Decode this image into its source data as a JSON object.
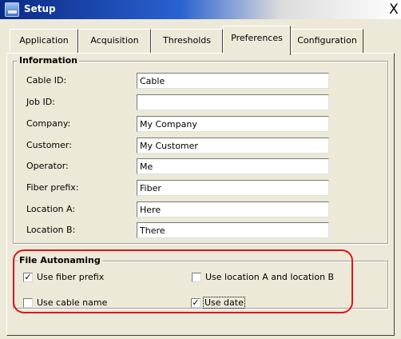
{
  "window": {
    "title": "Setup",
    "close_glyph": "X"
  },
  "tabs": [
    {
      "label": "Application"
    },
    {
      "label": "Acquisition"
    },
    {
      "label": "Thresholds"
    },
    {
      "label": "Preferences",
      "active": true
    },
    {
      "label": "Configuration"
    }
  ],
  "information": {
    "title": "Information",
    "fields": [
      {
        "label": "Cable ID:",
        "value": "Cable"
      },
      {
        "label": "Job ID:",
        "value": ""
      },
      {
        "label": "Company:",
        "value": "My Company"
      },
      {
        "label": "Customer:",
        "value": "My Customer"
      },
      {
        "label": "Operator:",
        "value": "Me"
      },
      {
        "label": "Fiber prefix:",
        "value": "Fiber"
      },
      {
        "label": "Location A:",
        "value": "Here"
      },
      {
        "label": "Location B:",
        "value": "There"
      }
    ]
  },
  "autonaming": {
    "title": "File Autonaming",
    "options": [
      {
        "label": "Use fiber prefix",
        "checked": true
      },
      {
        "label": "Use location A and location B",
        "checked": false
      },
      {
        "label": "Use cable name",
        "checked": false
      },
      {
        "label": "Use date",
        "checked": true
      }
    ]
  },
  "colors": {
    "highlight": "#d9161c",
    "titlebar": "#0a2a84"
  }
}
